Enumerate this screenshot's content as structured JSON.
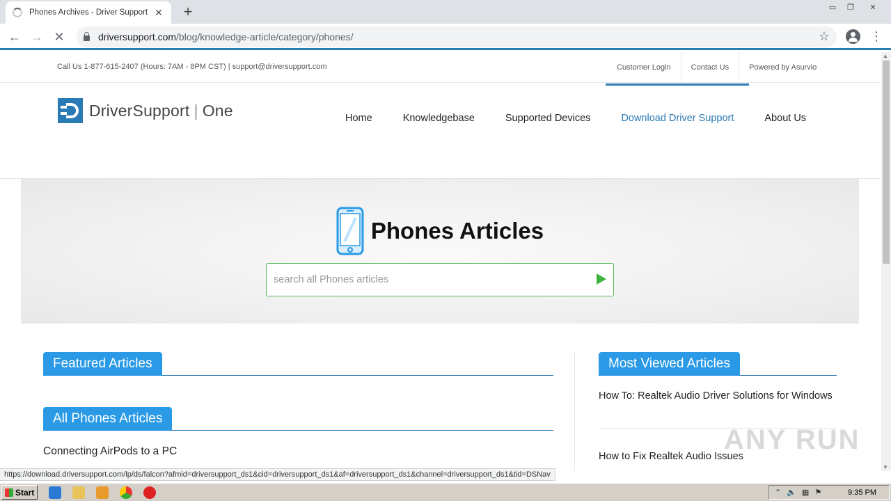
{
  "browser": {
    "tab_title": "Phones Archives - Driver Support",
    "url_host": "driversupport.com",
    "url_path": "/blog/knowledge-article/category/phones/",
    "status_url": "https://download.driversupport.com/lp/ds/falcon?afmid=driversupport_ds1&cid=driversupport_ds1&af=driversupport_ds1&channel=driversupport_ds1&tid=DSNav"
  },
  "topbar": {
    "contact": "Call Us 1-877-615-2407 (Hours: 7AM - 8PM CST)  |  support@driversupport.com",
    "links": [
      "Customer Login",
      "Contact Us",
      "Powered by Asurvio"
    ]
  },
  "logo": {
    "brand": "DriverSupport",
    "product": "One"
  },
  "nav": {
    "items": [
      "Home",
      "Knowledgebase",
      "Supported Devices",
      "Download Driver Support",
      "About Us"
    ],
    "active": "Download Driver Support"
  },
  "hero": {
    "title": "Phones Articles",
    "search_placeholder": "search all Phones articles"
  },
  "featured": {
    "heading": "Featured Articles"
  },
  "all_articles": {
    "heading": "All Phones Articles",
    "items": [
      "Connecting AirPods to a PC"
    ]
  },
  "most_viewed": {
    "heading": "Most Viewed Articles",
    "items": [
      "How To: Realtek Audio Driver Solutions for Windows",
      "How to Fix Realtek Audio Issues"
    ]
  },
  "watermark": "ANY RUN",
  "taskbar": {
    "start_label": "Start",
    "clock": "9:35 PM"
  },
  "colors": {
    "brand_blue": "#2a7ab5",
    "section_blue": "#2a9ae6",
    "search_green": "#5cb85c"
  }
}
